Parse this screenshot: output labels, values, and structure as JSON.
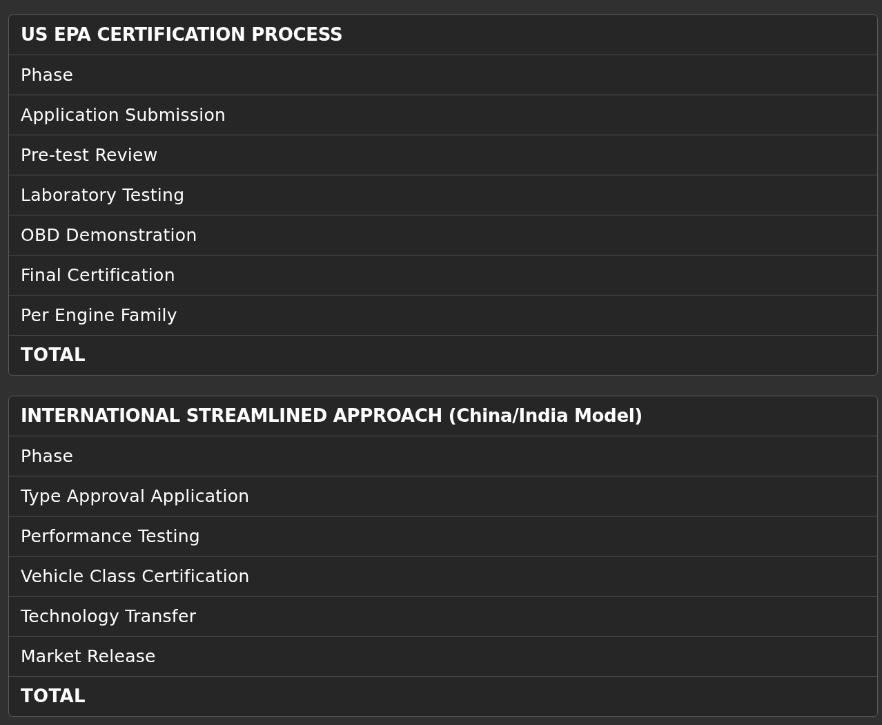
{
  "tables": [
    {
      "title": "US EPA CERTIFICATION PROCESS",
      "rows": [
        {
          "kind": "row",
          "text": "Phase"
        },
        {
          "kind": "row",
          "text": "Application Submission"
        },
        {
          "kind": "row",
          "text": "Pre-test Review"
        },
        {
          "kind": "row",
          "text": "Laboratory Testing"
        },
        {
          "kind": "row",
          "text": "OBD Demonstration"
        },
        {
          "kind": "row",
          "text": "Final Certification"
        },
        {
          "kind": "row",
          "text": "Per Engine Family"
        },
        {
          "kind": "total",
          "text": "TOTAL"
        }
      ]
    },
    {
      "title": "INTERNATIONAL STREAMLINED APPROACH (China/India Model)",
      "rows": [
        {
          "kind": "row",
          "text": "Phase"
        },
        {
          "kind": "row",
          "text": "Type Approval Application"
        },
        {
          "kind": "row",
          "text": "Performance Testing"
        },
        {
          "kind": "row",
          "text": "Vehicle Class Certification"
        },
        {
          "kind": "row",
          "text": "Technology Transfer"
        },
        {
          "kind": "row",
          "text": "Market Release"
        },
        {
          "kind": "total",
          "text": "TOTAL"
        }
      ]
    }
  ]
}
